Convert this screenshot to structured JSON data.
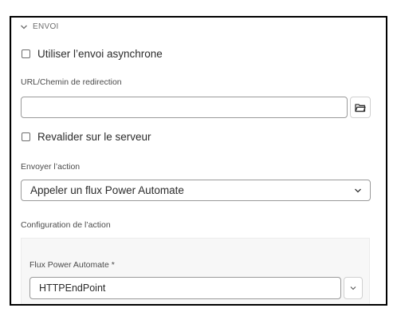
{
  "section": {
    "title": "ENVOI"
  },
  "async_checkbox": {
    "label": "Utiliser l’envoi asynchrone",
    "checked": false
  },
  "redirect": {
    "label": "URL/Chemin de redirection",
    "value": ""
  },
  "revalidate_checkbox": {
    "label": "Revalider sur le serveur",
    "checked": false
  },
  "send_action": {
    "label": "Envoyer l’action",
    "selected": "Appeler un flux Power Automate"
  },
  "action_config": {
    "label": "Configuration de l’action",
    "flow": {
      "label": "Flux Power Automate *",
      "value": "HTTPEndPoint"
    }
  },
  "icons": {
    "section_toggle": "chevron-down-icon",
    "browse": "folder-icon",
    "select": "chevron-down-icon"
  }
}
